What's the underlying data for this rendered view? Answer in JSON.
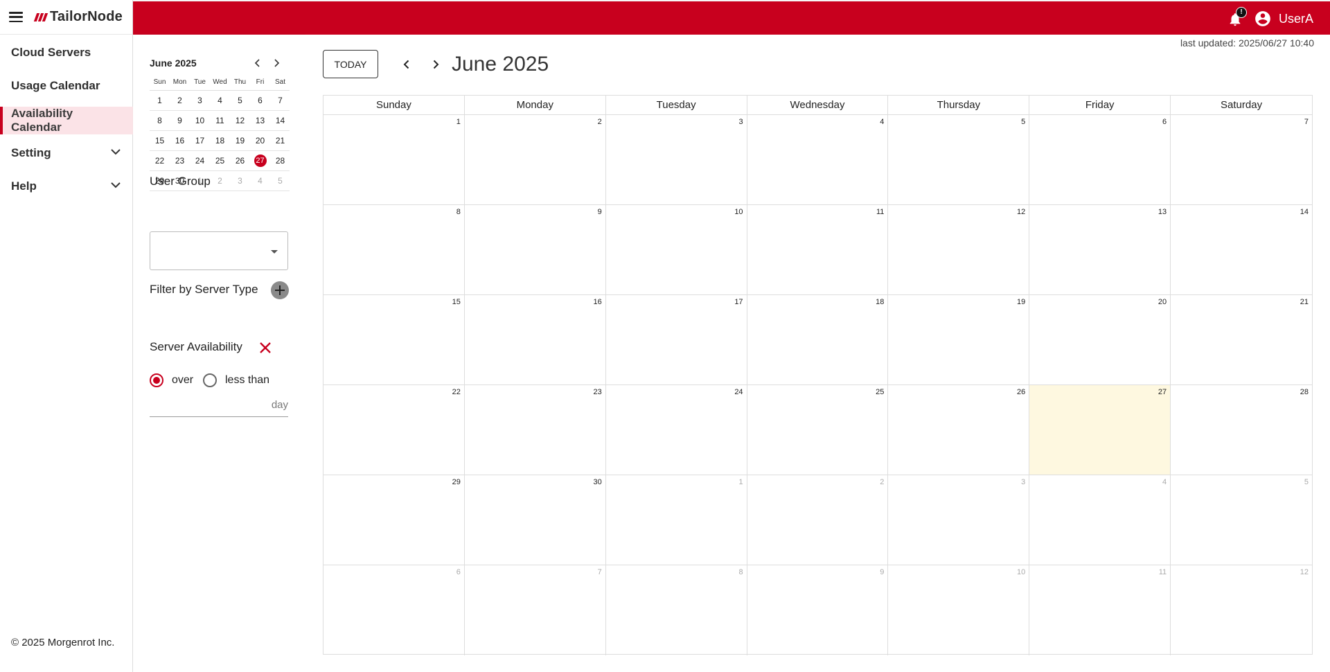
{
  "brand": {
    "name": "TailorNode"
  },
  "header": {
    "notification_count": "!",
    "user_name": "UserA"
  },
  "nav": {
    "items": [
      {
        "label": "Cloud Servers"
      },
      {
        "label": "Usage Calendar"
      },
      {
        "label": "Availability Calendar",
        "line1": "Availability",
        "line2": "Calendar",
        "active": true
      },
      {
        "label": "Setting",
        "expandable": true
      },
      {
        "label": "Help",
        "expandable": true
      }
    ],
    "copyright": "© 2025 Morgenrot Inc."
  },
  "mini_calendar": {
    "title": "June 2025",
    "weekdays": [
      "Sun",
      "Mon",
      "Tue",
      "Wed",
      "Thu",
      "Fri",
      "Sat"
    ],
    "weeks": [
      [
        "1",
        "2",
        "3",
        "4",
        "5",
        "6",
        "7"
      ],
      [
        "8",
        "9",
        "10",
        "11",
        "12",
        "13",
        "14"
      ],
      [
        "15",
        "16",
        "17",
        "18",
        "19",
        "20",
        "21"
      ],
      [
        "22",
        "23",
        "24",
        "25",
        "26",
        "27",
        "28"
      ],
      [
        "29",
        "30",
        "1",
        "2",
        "3",
        "4",
        "5"
      ]
    ],
    "today": "27"
  },
  "filters": {
    "user_group_label": "User Group",
    "user_group_value": "",
    "server_type_label": "Filter by Server Type",
    "availability_label": "Server Availability",
    "radio_over": "over",
    "radio_less": "less than",
    "selected": "over",
    "day_value": "",
    "day_unit": "day"
  },
  "main": {
    "last_updated": "last updated: 2025/06/27 10:40",
    "today_button": "TODAY",
    "month_title": "June 2025",
    "weekdays": [
      "Sunday",
      "Monday",
      "Tuesday",
      "Wednesday",
      "Thursday",
      "Friday",
      "Saturday"
    ],
    "weeks": [
      [
        "1",
        "2",
        "3",
        "4",
        "5",
        "6",
        "7"
      ],
      [
        "8",
        "9",
        "10",
        "11",
        "12",
        "13",
        "14"
      ],
      [
        "15",
        "16",
        "17",
        "18",
        "19",
        "20",
        "21"
      ],
      [
        "22",
        "23",
        "24",
        "25",
        "26",
        "27",
        "28"
      ],
      [
        "29",
        "30",
        "1",
        "2",
        "3",
        "4",
        "5"
      ],
      [
        "6",
        "7",
        "8",
        "9",
        "10",
        "11",
        "12"
      ]
    ],
    "today": "27"
  },
  "colors": {
    "brand_red": "#c8001e",
    "today_highlight": "#fef8e0",
    "active_nav_bg": "#fbe3e7"
  }
}
